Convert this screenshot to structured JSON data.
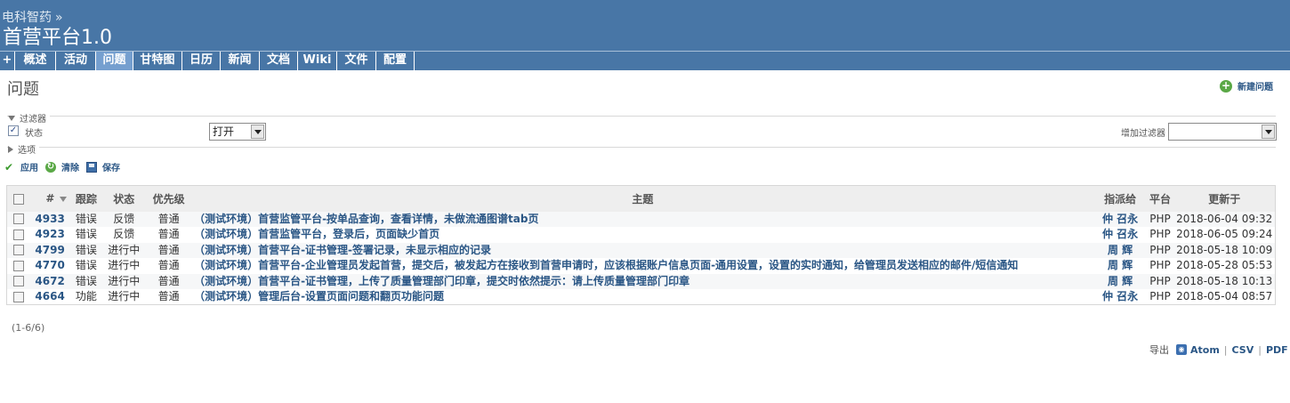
{
  "header": {
    "breadcrumb": "电科智药",
    "breadcrumb_sep": "»",
    "project_title": "首营平台1.0"
  },
  "menu": {
    "tabs": [
      {
        "label": "+"
      },
      {
        "label": "概述"
      },
      {
        "label": "活动"
      },
      {
        "label": "问题"
      },
      {
        "label": "甘特图"
      },
      {
        "label": "日历"
      },
      {
        "label": "新闻"
      },
      {
        "label": "文档"
      },
      {
        "label": "Wiki"
      },
      {
        "label": "文件"
      },
      {
        "label": "配置"
      }
    ],
    "selected": "问题"
  },
  "page": {
    "title": "问题",
    "new_issue": "新建问题"
  },
  "filters": {
    "legend": "过滤器",
    "status_label": "状态",
    "status_value": "打开",
    "add_filter_label": "增加过滤器",
    "add_filter_value": "",
    "options_legend": "选项"
  },
  "actions": {
    "apply": "应用",
    "clear": "清除",
    "save": "保存"
  },
  "table": {
    "headers": {
      "id": "#",
      "tracker": "跟踪",
      "status": "状态",
      "priority": "优先级",
      "subject": "主题",
      "assignee": "指派给",
      "platform": "平台",
      "updated": "更新于"
    },
    "rows": [
      {
        "id": "4933",
        "tracker": "错误",
        "status": "反馈",
        "priority": "普通",
        "subject": "（测试环境）首营监管平台-按单品查询，查看详情，未做流通图谱tab页",
        "assignee": "仲 召永",
        "platform": "PHP",
        "updated": "2018-06-04 09:32"
      },
      {
        "id": "4923",
        "tracker": "错误",
        "status": "反馈",
        "priority": "普通",
        "subject": "（测试环境）首营监管平台，登录后，页面缺少首页",
        "assignee": "仲 召永",
        "platform": "PHP",
        "updated": "2018-06-05 09:24"
      },
      {
        "id": "4799",
        "tracker": "错误",
        "status": "进行中",
        "priority": "普通",
        "subject": "（测试环境）首营平台-证书管理-签署记录，未显示相应的记录",
        "assignee": "周 辉",
        "platform": "PHP",
        "updated": "2018-05-18 10:09"
      },
      {
        "id": "4770",
        "tracker": "错误",
        "status": "进行中",
        "priority": "普通",
        "subject": "（测试环境）首营平台-企业管理员发起首营，提交后，被发起方在接收到首营申请时，应该根据账户信息页面-通用设置，设置的实时通知，给管理员发送相应的邮件/短信通知",
        "assignee": "周 辉",
        "platform": "PHP",
        "updated": "2018-05-28 05:53"
      },
      {
        "id": "4672",
        "tracker": "错误",
        "status": "进行中",
        "priority": "普通",
        "subject": "（测试环境）首营平台-证书管理，上传了质量管理部门印章，提交时依然提示：请上传质量管理部门印章",
        "assignee": "周 辉",
        "platform": "PHP",
        "updated": "2018-05-18 10:13"
      },
      {
        "id": "4664",
        "tracker": "功能",
        "status": "进行中",
        "priority": "普通",
        "subject": "（测试环境）管理后台-设置页面问题和翻页功能问题",
        "assignee": "仲 召永",
        "platform": "PHP",
        "updated": "2018-05-04 08:57"
      }
    ]
  },
  "pagination": "(1-6/6)",
  "export": {
    "label": "导出",
    "formats": [
      "Atom",
      "CSV",
      "PDF"
    ]
  },
  "colors": {
    "header_bg": "#4876a6",
    "selected_tab": "#759fcf",
    "link": "#2a5685"
  }
}
